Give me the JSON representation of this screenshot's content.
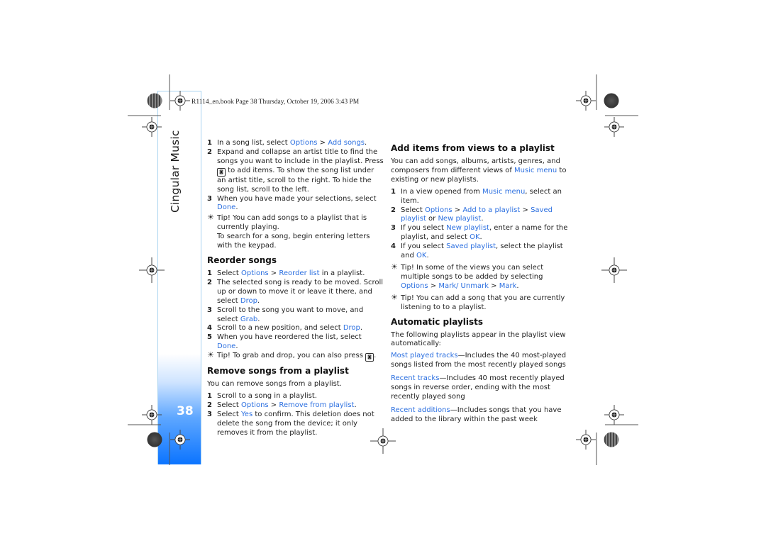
{
  "header": {
    "file_line": "R1114_en.book  Page 38  Thursday, October 19, 2006  3:43 PM"
  },
  "sidebar": {
    "section_title": "Cingular Music",
    "page_number": "38"
  },
  "colors": {
    "keyword": "#2b6fe0",
    "sidebar_gradient_end": "#0a73ff"
  },
  "left_column": {
    "intro_steps": [
      {
        "num": "1",
        "parts": [
          {
            "t": "In a song list, select "
          },
          {
            "t": "Options",
            "kw": true
          },
          {
            "t": " > "
          },
          {
            "t": "Add songs",
            "kw": true
          },
          {
            "t": "."
          }
        ]
      },
      {
        "num": "2",
        "parts": [
          {
            "t": "Expand and collapse an artist title to find the songs you want to include in the playlist.  Press "
          },
          {
            "key": "select-key"
          },
          {
            "t": " to add items.  To show the song list under an artist title, scroll to the right.  To hide the song list, scroll to the left."
          }
        ]
      },
      {
        "num": "3",
        "parts": [
          {
            "t": "When you have made your selections, select "
          },
          {
            "t": "Done",
            "kw": true
          },
          {
            "t": "."
          }
        ]
      }
    ],
    "intro_tip": {
      "icon": "tip-icon",
      "lines": [
        "Tip! You can add songs to a playlist that is currently playing.",
        "To search for a song, begin entering letters with the keypad."
      ]
    },
    "reorder": {
      "heading": "Reorder songs",
      "steps": [
        {
          "num": "1",
          "parts": [
            {
              "t": "Select "
            },
            {
              "t": "Options",
              "kw": true
            },
            {
              "t": " > "
            },
            {
              "t": "Reorder list",
              "kw": true
            },
            {
              "t": " in a playlist."
            }
          ]
        },
        {
          "num": "2",
          "parts": [
            {
              "t": "The selected song is ready to be moved. Scroll up or down to move it or leave it there, and select "
            },
            {
              "t": "Drop",
              "kw": true
            },
            {
              "t": "."
            }
          ]
        },
        {
          "num": "3",
          "parts": [
            {
              "t": "Scroll to the song you want to move, and select "
            },
            {
              "t": "Grab",
              "kw": true
            },
            {
              "t": "."
            }
          ]
        },
        {
          "num": "4",
          "parts": [
            {
              "t": "Scroll to a new position, and select "
            },
            {
              "t": "Drop",
              "kw": true
            },
            {
              "t": "."
            }
          ]
        },
        {
          "num": "5",
          "parts": [
            {
              "t": "When you have reordered the list, select "
            },
            {
              "t": "Done",
              "kw": true
            },
            {
              "t": "."
            }
          ]
        }
      ],
      "tip": {
        "parts": [
          {
            "t": "Tip! To grab and drop, you can also press "
          },
          {
            "key": "select-key"
          },
          {
            "t": "."
          }
        ]
      }
    },
    "remove": {
      "heading": "Remove songs from a playlist",
      "intro": "You can remove songs from a playlist.",
      "steps": [
        {
          "num": "1",
          "parts": [
            {
              "t": "Scroll to a song in a playlist."
            }
          ]
        },
        {
          "num": "2",
          "parts": [
            {
              "t": "Select "
            },
            {
              "t": "Options",
              "kw": true
            },
            {
              "t": " > "
            },
            {
              "t": "Remove from playlist",
              "kw": true
            },
            {
              "t": "."
            }
          ]
        },
        {
          "num": "3",
          "parts": [
            {
              "t": "Select "
            },
            {
              "t": "Yes",
              "kw": true
            },
            {
              "t": " to confirm. This deletion does not delete the song from the device; it only removes it from the playlist."
            }
          ]
        }
      ]
    }
  },
  "right_column": {
    "add_items": {
      "heading": "Add items from views to a playlist",
      "intro": [
        {
          "t": "You can add songs, albums, artists, genres, and composers from different views of "
        },
        {
          "t": "Music menu",
          "kw": true
        },
        {
          "t": " to existing or new playlists."
        }
      ],
      "steps": [
        {
          "num": "1",
          "parts": [
            {
              "t": "In a view opened from "
            },
            {
              "t": "Music menu",
              "kw": true
            },
            {
              "t": ", select an item."
            }
          ]
        },
        {
          "num": "2",
          "parts": [
            {
              "t": "Select "
            },
            {
              "t": "Options",
              "kw": true
            },
            {
              "t": " > "
            },
            {
              "t": "Add to a playlist",
              "kw": true
            },
            {
              "t": " > "
            },
            {
              "t": "Saved playlist",
              "kw": true
            },
            {
              "t": " or "
            },
            {
              "t": "New playlist",
              "kw": true
            },
            {
              "t": "."
            }
          ]
        },
        {
          "num": "3",
          "parts": [
            {
              "t": "If you select "
            },
            {
              "t": "New playlist",
              "kw": true
            },
            {
              "t": ", enter a name for the playlist, and select "
            },
            {
              "t": "OK",
              "kw": true
            },
            {
              "t": "."
            }
          ]
        },
        {
          "num": "4",
          "parts": [
            {
              "t": "If you select "
            },
            {
              "t": "Saved playlist",
              "kw": true
            },
            {
              "t": ",  select the playlist and "
            },
            {
              "t": "OK",
              "kw": true
            },
            {
              "t": "."
            }
          ]
        }
      ],
      "tips": [
        {
          "parts": [
            {
              "t": "Tip! In some of the views you can select multiple songs to be added by selecting "
            },
            {
              "t": "Options",
              "kw": true
            },
            {
              "t": " > "
            },
            {
              "t": "Mark/ Unmark",
              "kw": true
            },
            {
              "t": " > "
            },
            {
              "t": "Mark",
              "kw": true
            },
            {
              "t": "."
            }
          ]
        },
        {
          "parts": [
            {
              "t": "Tip! You can add a song that you are currently listening to to a playlist."
            }
          ]
        }
      ]
    },
    "automatic": {
      "heading": "Automatic playlists",
      "intro": "The following playlists appear in the playlist view automatically:",
      "items": [
        {
          "name": "Most played tracks",
          "desc": "—Includes the 40 most-played songs listed from the most recently played songs"
        },
        {
          "name": "Recent tracks",
          "desc": "—Includes 40 most recently played songs in reverse order, ending with the most recently played song"
        },
        {
          "name": "Recent additions",
          "desc": "—Includes songs that you have added to the library within the past week"
        }
      ]
    }
  }
}
